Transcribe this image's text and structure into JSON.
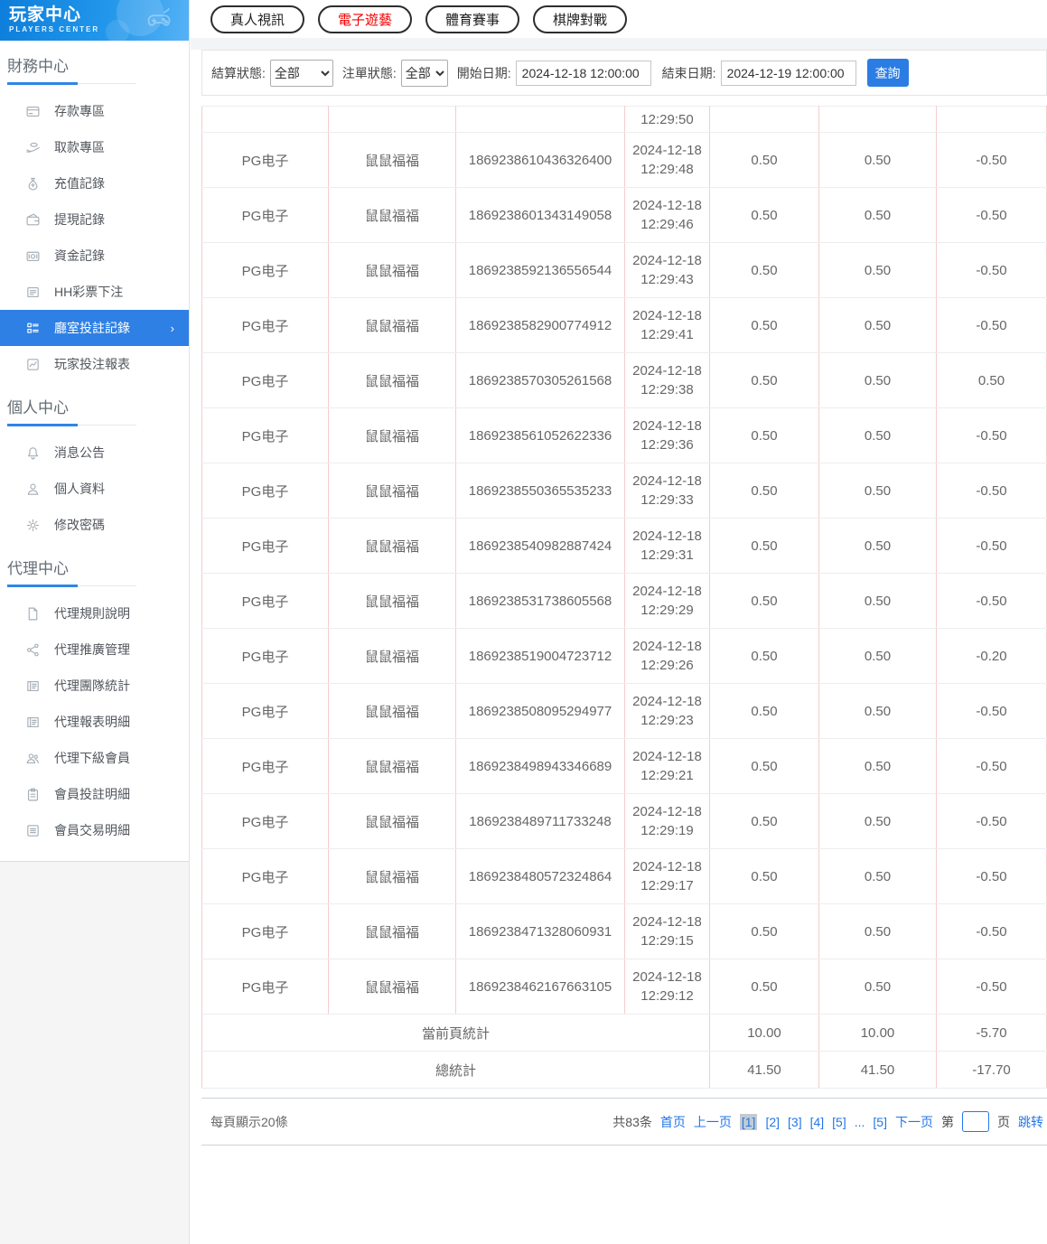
{
  "brand": {
    "title": "玩家中心",
    "subtitle": "PLAYERS CENTER"
  },
  "sidebar": {
    "sections": [
      {
        "title": "財務中心",
        "items": [
          {
            "label": "存款專區"
          },
          {
            "label": "取款專區"
          },
          {
            "label": "充值記錄"
          },
          {
            "label": "提現記錄"
          },
          {
            "label": "資金記錄"
          },
          {
            "label": "HH彩票下注"
          },
          {
            "label": "廳室投註記錄",
            "active": true
          },
          {
            "label": "玩家投注報表"
          }
        ]
      },
      {
        "title": "個人中心",
        "items": [
          {
            "label": "消息公告"
          },
          {
            "label": "個人資料"
          },
          {
            "label": "修改密碼"
          }
        ]
      },
      {
        "title": "代理中心",
        "items": [
          {
            "label": "代理規則說明"
          },
          {
            "label": "代理推廣管理"
          },
          {
            "label": "代理團隊統計"
          },
          {
            "label": "代理報表明細"
          },
          {
            "label": "代理下級會員"
          },
          {
            "label": "會員投註明細"
          },
          {
            "label": "會員交易明細"
          }
        ]
      }
    ]
  },
  "tabs": [
    {
      "label": "真人視訊",
      "active": false
    },
    {
      "label": "電子遊藝",
      "active": true
    },
    {
      "label": "體育賽事",
      "active": false
    },
    {
      "label": "棋牌對戰",
      "active": false
    }
  ],
  "filters": {
    "settle_label": "結算狀態:",
    "settle_value": "全部",
    "order_label": "注單狀態:",
    "order_value": "全部",
    "start_label": "開始日期:",
    "start_value": "2024-12-18 12:00:00",
    "end_label": "結束日期:",
    "end_value": "2024-12-19 12:00:00",
    "search_label": "查詢"
  },
  "table": {
    "partial_row_time": "12:29:50",
    "rows": [
      {
        "provider": "PG电子",
        "game": "鼠鼠福福",
        "order": "1869238610436326400",
        "date": "2024-12-18",
        "time": "12:29:48",
        "bet": "0.50",
        "valid": "0.50",
        "result": "-0.50"
      },
      {
        "provider": "PG电子",
        "game": "鼠鼠福福",
        "order": "1869238601343149058",
        "date": "2024-12-18",
        "time": "12:29:46",
        "bet": "0.50",
        "valid": "0.50",
        "result": "-0.50"
      },
      {
        "provider": "PG电子",
        "game": "鼠鼠福福",
        "order": "1869238592136556544",
        "date": "2024-12-18",
        "time": "12:29:43",
        "bet": "0.50",
        "valid": "0.50",
        "result": "-0.50"
      },
      {
        "provider": "PG电子",
        "game": "鼠鼠福福",
        "order": "1869238582900774912",
        "date": "2024-12-18",
        "time": "12:29:41",
        "bet": "0.50",
        "valid": "0.50",
        "result": "-0.50"
      },
      {
        "provider": "PG电子",
        "game": "鼠鼠福福",
        "order": "1869238570305261568",
        "date": "2024-12-18",
        "time": "12:29:38",
        "bet": "0.50",
        "valid": "0.50",
        "result": "0.50"
      },
      {
        "provider": "PG电子",
        "game": "鼠鼠福福",
        "order": "1869238561052622336",
        "date": "2024-12-18",
        "time": "12:29:36",
        "bet": "0.50",
        "valid": "0.50",
        "result": "-0.50"
      },
      {
        "provider": "PG电子",
        "game": "鼠鼠福福",
        "order": "1869238550365535233",
        "date": "2024-12-18",
        "time": "12:29:33",
        "bet": "0.50",
        "valid": "0.50",
        "result": "-0.50"
      },
      {
        "provider": "PG电子",
        "game": "鼠鼠福福",
        "order": "1869238540982887424",
        "date": "2024-12-18",
        "time": "12:29:31",
        "bet": "0.50",
        "valid": "0.50",
        "result": "-0.50"
      },
      {
        "provider": "PG电子",
        "game": "鼠鼠福福",
        "order": "1869238531738605568",
        "date": "2024-12-18",
        "time": "12:29:29",
        "bet": "0.50",
        "valid": "0.50",
        "result": "-0.50"
      },
      {
        "provider": "PG电子",
        "game": "鼠鼠福福",
        "order": "1869238519004723712",
        "date": "2024-12-18",
        "time": "12:29:26",
        "bet": "0.50",
        "valid": "0.50",
        "result": "-0.20"
      },
      {
        "provider": "PG电子",
        "game": "鼠鼠福福",
        "order": "1869238508095294977",
        "date": "2024-12-18",
        "time": "12:29:23",
        "bet": "0.50",
        "valid": "0.50",
        "result": "-0.50"
      },
      {
        "provider": "PG电子",
        "game": "鼠鼠福福",
        "order": "1869238498943346689",
        "date": "2024-12-18",
        "time": "12:29:21",
        "bet": "0.50",
        "valid": "0.50",
        "result": "-0.50"
      },
      {
        "provider": "PG电子",
        "game": "鼠鼠福福",
        "order": "1869238489711733248",
        "date": "2024-12-18",
        "time": "12:29:19",
        "bet": "0.50",
        "valid": "0.50",
        "result": "-0.50"
      },
      {
        "provider": "PG电子",
        "game": "鼠鼠福福",
        "order": "1869238480572324864",
        "date": "2024-12-18",
        "time": "12:29:17",
        "bet": "0.50",
        "valid": "0.50",
        "result": "-0.50"
      },
      {
        "provider": "PG电子",
        "game": "鼠鼠福福",
        "order": "1869238471328060931",
        "date": "2024-12-18",
        "time": "12:29:15",
        "bet": "0.50",
        "valid": "0.50",
        "result": "-0.50"
      },
      {
        "provider": "PG电子",
        "game": "鼠鼠福福",
        "order": "1869238462167663105",
        "date": "2024-12-18",
        "time": "12:29:12",
        "bet": "0.50",
        "valid": "0.50",
        "result": "-0.50"
      }
    ],
    "summary": [
      {
        "label": "當前頁統計",
        "bet": "10.00",
        "valid": "10.00",
        "result": "-5.70"
      },
      {
        "label": "總統計",
        "bet": "41.50",
        "valid": "41.50",
        "result": "-17.70"
      }
    ]
  },
  "pagination": {
    "page_size_text": "每頁顯示20條",
    "total_text": "共83条",
    "first": "首页",
    "prev": "上一页",
    "pages": [
      "[1]",
      "[2]",
      "[3]",
      "[4]",
      "[5]"
    ],
    "ellipsis": "...",
    "last_page": "[5]",
    "next": "下一页",
    "jump_prefix": "第",
    "jump_suffix": "页",
    "jump_action": "跳转",
    "jump_value": ""
  },
  "colors": {
    "accent_blue": "#2e80e4",
    "link_blue": "#2376e8",
    "active_tab_red": "#f20000",
    "table_vertical_border": "#f4cdcd"
  }
}
